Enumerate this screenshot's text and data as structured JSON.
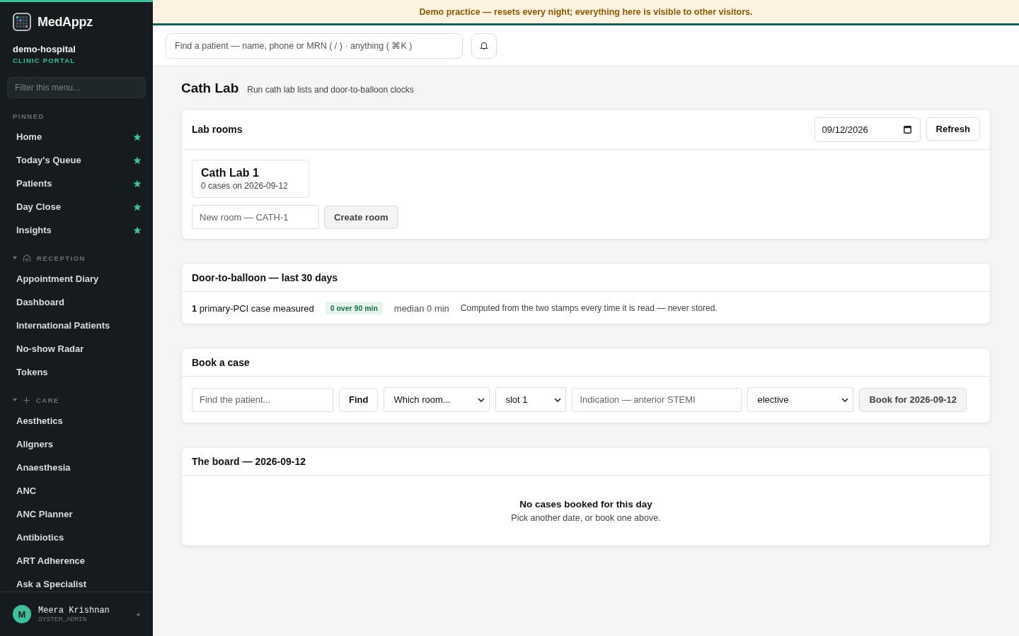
{
  "sidebar": {
    "brand": "MedAppz",
    "org": "demo-hospital",
    "portal": "CLINIC PORTAL",
    "filter": {
      "placeholder": "Filter this menu..."
    },
    "sections": [
      {
        "title": "PINNED",
        "kind": "pinned",
        "items": [
          {
            "label": "Home",
            "pinned": true
          },
          {
            "label": "Today's Queue",
            "pinned": true
          },
          {
            "label": "Patients",
            "pinned": true
          },
          {
            "label": "Day Close",
            "pinned": true
          },
          {
            "label": "Insights",
            "pinned": true
          }
        ]
      },
      {
        "title": "RECEPTION",
        "kind": "home",
        "expanded": true,
        "items": [
          {
            "label": "Appointment Diary",
            "pinned": false
          },
          {
            "label": "Dashboard",
            "pinned": false
          },
          {
            "label": "International Patients",
            "pinned": false
          },
          {
            "label": "No-show Radar",
            "pinned": false
          },
          {
            "label": "Tokens",
            "pinned": false
          }
        ]
      },
      {
        "title": "CARE",
        "kind": "plus",
        "expanded": true,
        "items": [
          {
            "label": "Aesthetics",
            "pinned": false
          },
          {
            "label": "Aligners",
            "pinned": false
          },
          {
            "label": "Anaesthesia",
            "pinned": false
          },
          {
            "label": "ANC",
            "pinned": false
          },
          {
            "label": "ANC Planner",
            "pinned": false
          },
          {
            "label": "Antibiotics",
            "pinned": false
          },
          {
            "label": "ART Adherence",
            "pinned": false
          },
          {
            "label": "Ask a Specialist",
            "pinned": false
          }
        ]
      }
    ],
    "user": {
      "initial": "M",
      "name": "Meera Krishnan",
      "role": "SYSTEM_ADMIN"
    }
  },
  "banner": "Demo practice — resets every night; everything here is visible to other visitors.",
  "search": {
    "placeholder": "Find a patient — name, phone or MRN ( / ) · anything ( ⌘K )"
  },
  "page": {
    "title": "Cath Lab",
    "subtitle": "Run cath lab lists and door-to-balloon clocks"
  },
  "lab_rooms": {
    "title": "Lab rooms",
    "date": "09/12/2026",
    "refresh": "Refresh",
    "rooms": [
      {
        "name": "Cath Lab 1",
        "cases": "0 cases on 2026-09-12"
      }
    ],
    "new_room": {
      "placeholder": "New room — CATH-1"
    },
    "create": "Create room"
  },
  "door_to_balloon": {
    "title": "Door-to-balloon — last 30 days",
    "measured": "**1** primary-PCI case measured",
    "over": "0 over 90 min",
    "median": "median 0 min",
    "note": "Computed from the two stamps every time it is read — never stored."
  },
  "book": {
    "title": "Book a case",
    "patient": {
      "placeholder": "Find the patient..."
    },
    "find": "Find",
    "room": "Which room...",
    "slot": "slot 1",
    "indication": {
      "placeholder": "Indication — anterior STEMI"
    },
    "priority": "elective",
    "submit": "Book for 2026-09-12"
  },
  "board": {
    "title": "The board — 2026-09-12",
    "empty_title": "No cases booked for this day",
    "empty_text": "Pick another date, or book one above."
  }
}
